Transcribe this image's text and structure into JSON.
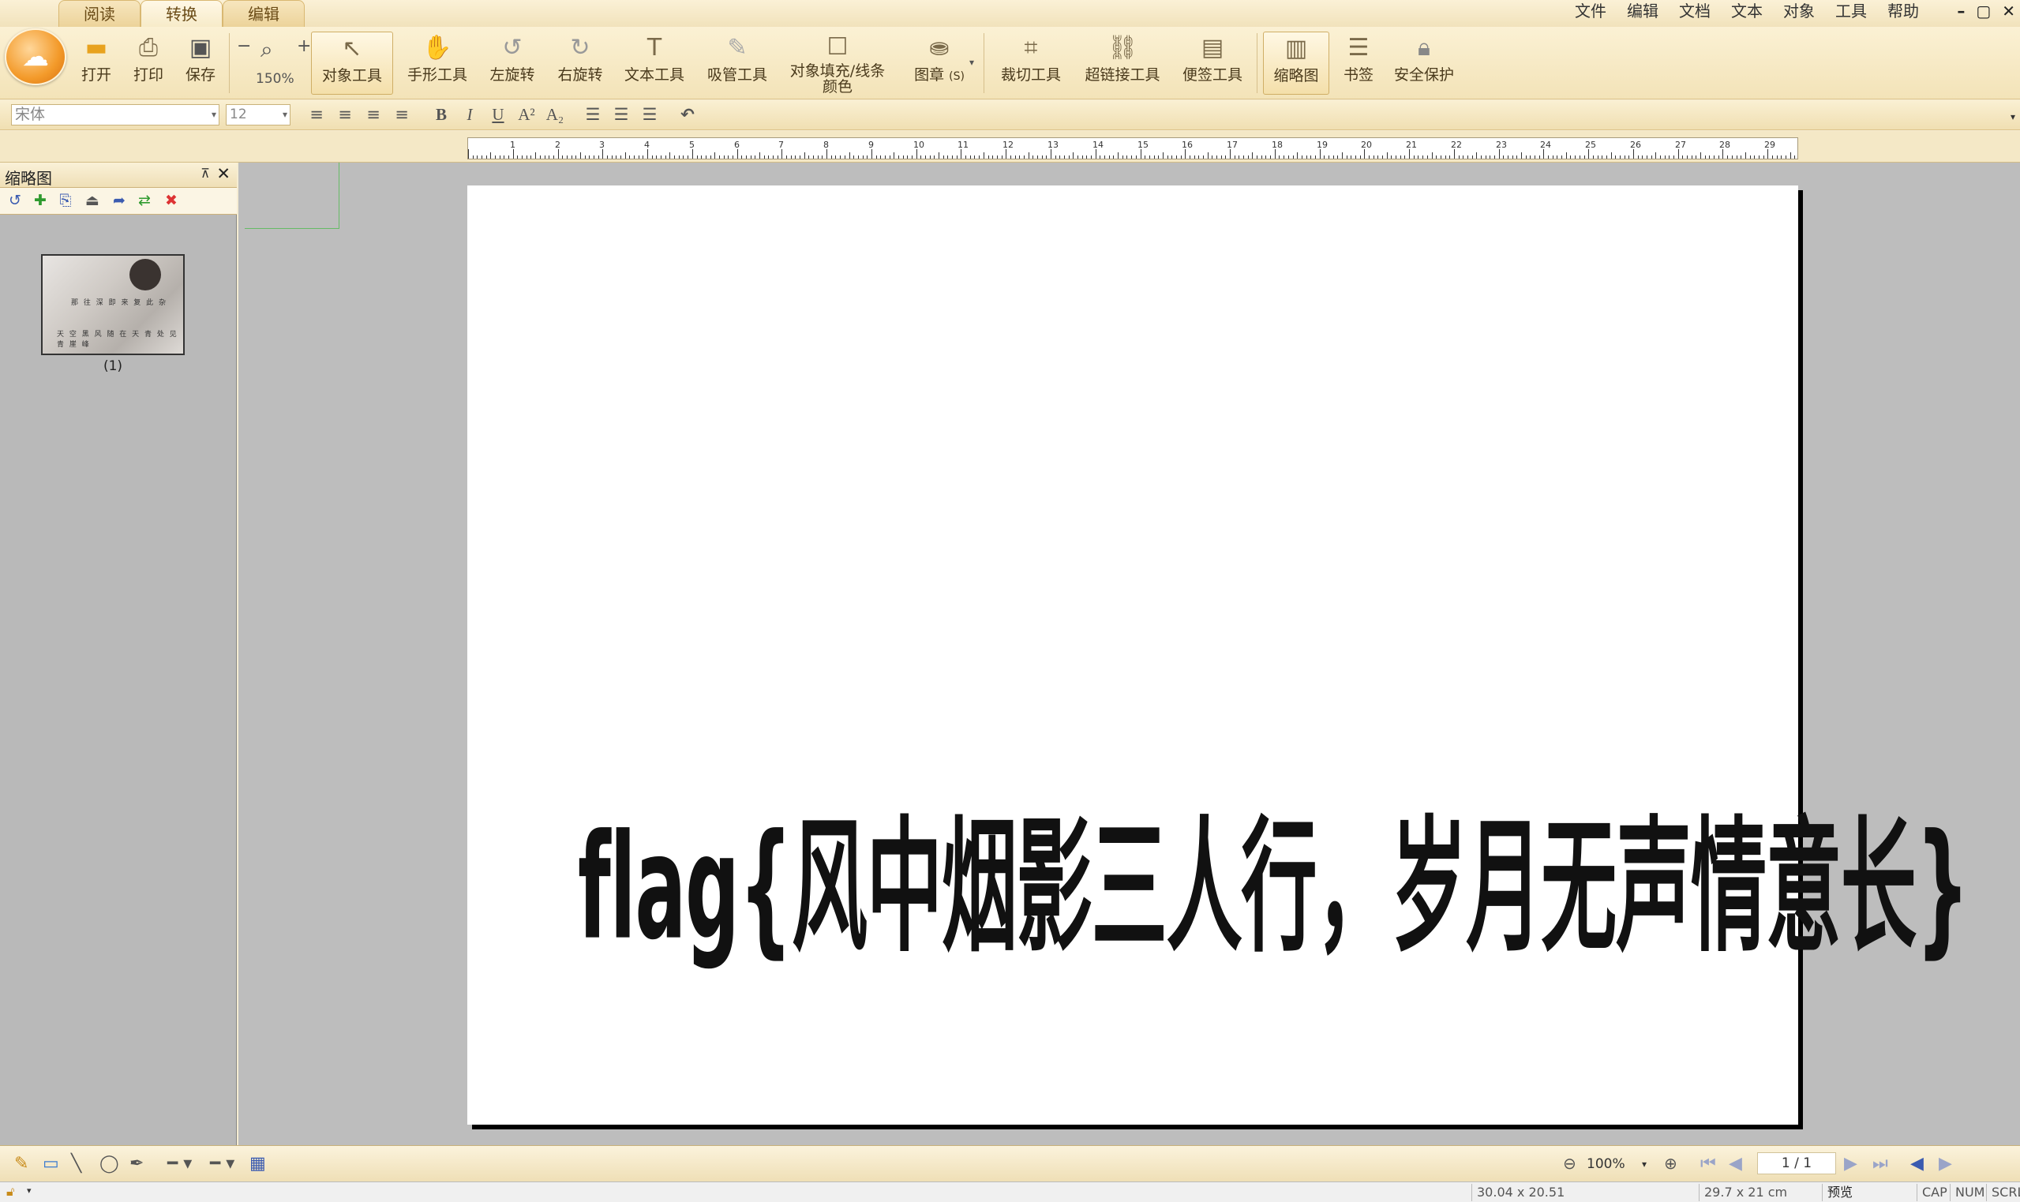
{
  "ribbon_tabs": [
    "阅读",
    "转换",
    "编辑"
  ],
  "menu": [
    "文件",
    "编辑",
    "文档",
    "文本",
    "对象",
    "工具",
    "帮助"
  ],
  "window_controls": [
    "–",
    "▢",
    "✕"
  ],
  "toolbar": {
    "open": "打开",
    "print": "打印",
    "save": "保存",
    "zoom_value": "150%",
    "object_tool": "对象工具",
    "hand_tool": "手形工具",
    "rotate_left": "左旋转",
    "rotate_right": "右旋转",
    "text_tool": "文本工具",
    "eyedropper_tool": "吸管工具",
    "fill_line_color_1": "对象填充/线条",
    "fill_line_color_2": "颜色",
    "stamp": "图章",
    "stamp_count": "(S)",
    "crop_tool": "裁切工具",
    "hyperlink_tool": "超链接工具",
    "note_tool": "便签工具",
    "thumbnails": "缩略图",
    "bookmarks": "书签",
    "security": "安全保护"
  },
  "format": {
    "font": "宋体",
    "size": "12"
  },
  "ruler_numbers": [
    "1",
    "2",
    "3",
    "4",
    "5",
    "6",
    "7",
    "8",
    "9",
    "10",
    "11",
    "12",
    "13",
    "14",
    "15",
    "16",
    "17",
    "18",
    "19",
    "20",
    "21",
    "22",
    "23",
    "24",
    "25",
    "26",
    "27",
    "28",
    "29"
  ],
  "side_panel": {
    "title": "缩略图",
    "pin": "⊼",
    "close": "✕",
    "thumb_line1": "那 往 深 即 来 复 此 杂",
    "thumb_line2": "天 空 黑 风 随 在 天 青 处 见 青 崖 峰",
    "thumb_label": "(1)"
  },
  "page": {
    "flag_text": "flag{风中烟影三人行，岁月无声情意长}"
  },
  "bottom": {
    "zoom": "100%",
    "page": "1 / 1"
  },
  "status": {
    "size1": "30.04 x 20.51 cm",
    "size2": "29.7 x 21 cm",
    "mode": "预览",
    "cap": "CAP",
    "num": "NUM",
    "scrl": "SCRL"
  }
}
